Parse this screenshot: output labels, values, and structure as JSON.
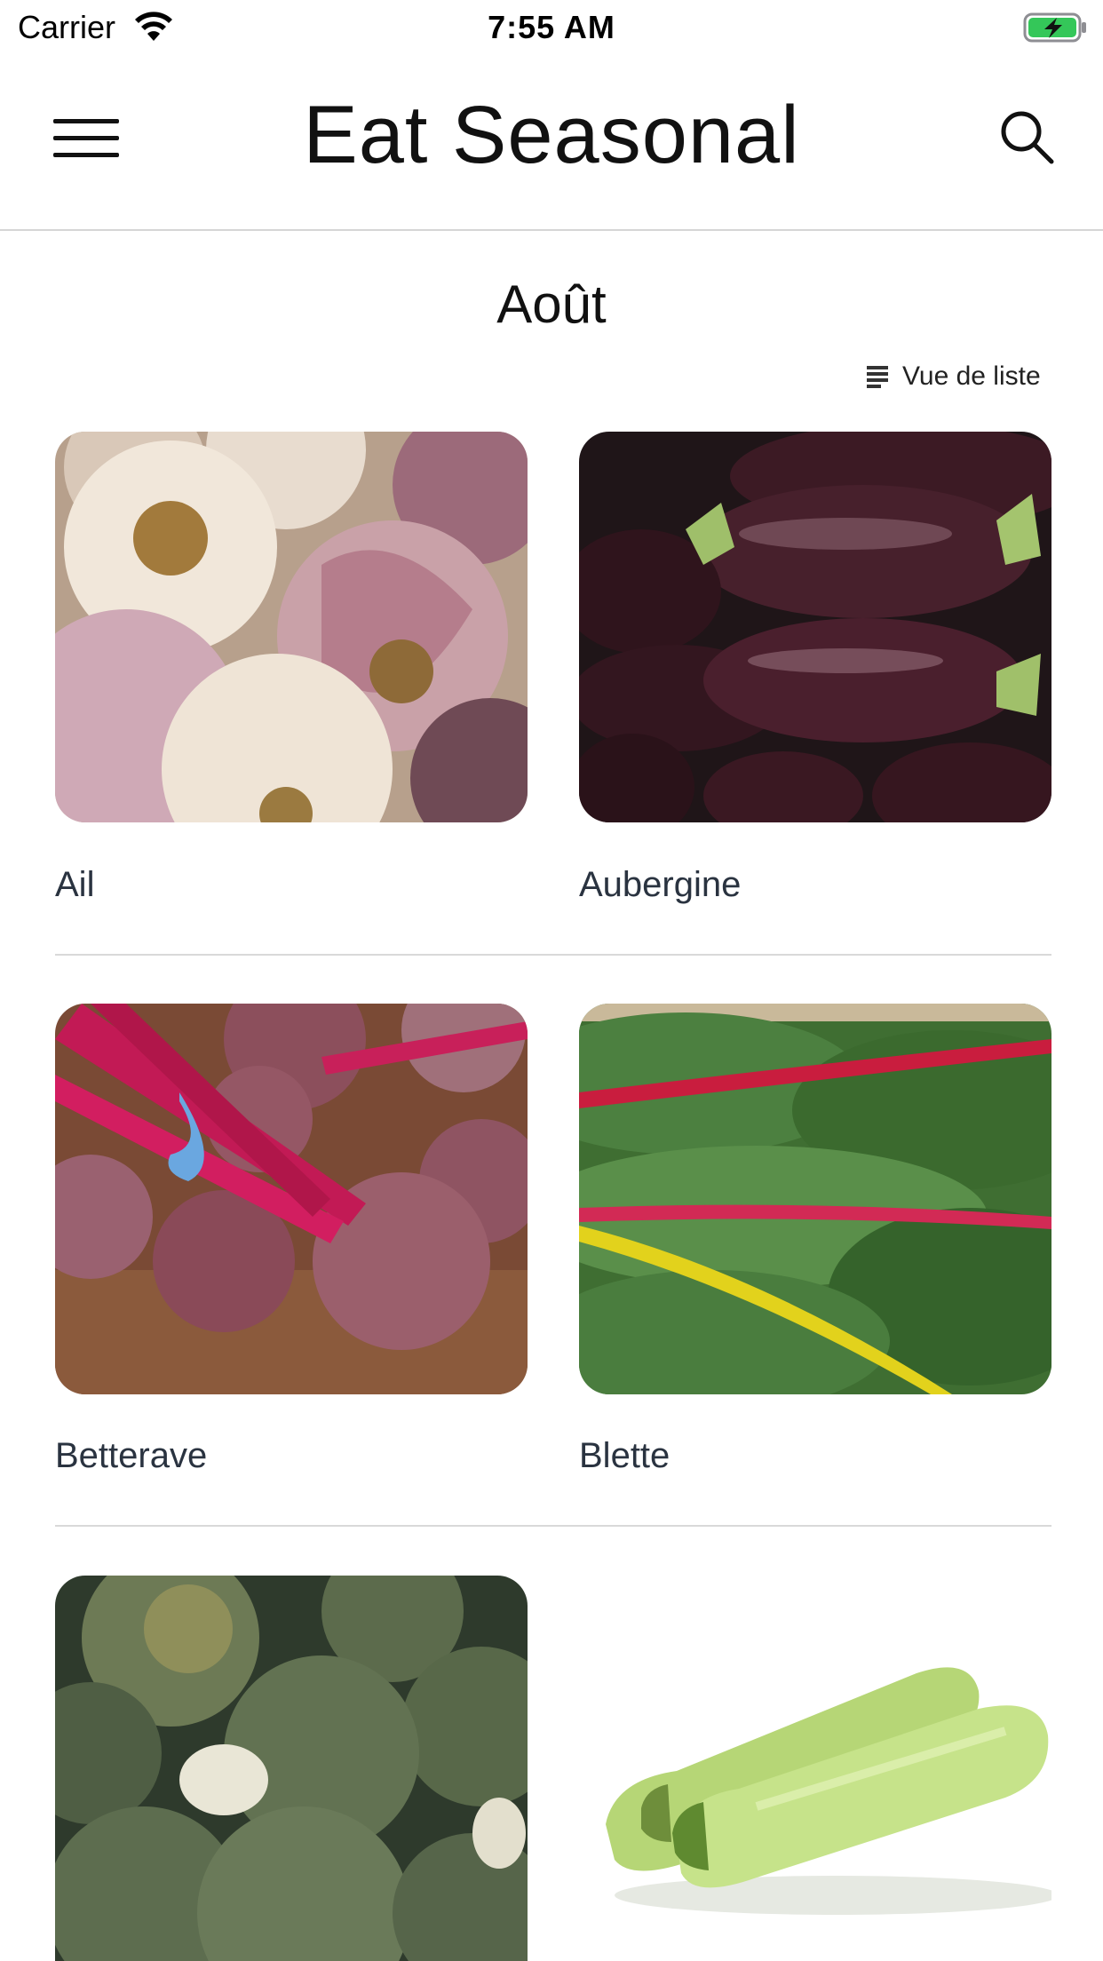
{
  "status_bar": {
    "carrier": "Carrier",
    "time": "7:55 AM",
    "wifi_icon": "wifi-icon",
    "battery_icon": "battery-charging-icon",
    "battery_color": "#34c759"
  },
  "header": {
    "title": "Eat Seasonal",
    "menu_icon": "hamburger-menu-icon",
    "search_icon": "search-icon"
  },
  "month": {
    "title": "Août"
  },
  "view_toggle": {
    "label": "Vue de liste",
    "icon": "list-icon"
  },
  "items": [
    {
      "name": "Ail",
      "image": "garlic-photo"
    },
    {
      "name": "Aubergine",
      "image": "eggplant-photo"
    },
    {
      "name": "Betterave",
      "image": "beetroot-photo"
    },
    {
      "name": "Blette",
      "image": "chard-photo"
    },
    {
      "name": "",
      "image": "broccoli-photo"
    },
    {
      "name": "",
      "image": "zucchini-photo"
    }
  ],
  "colors": {
    "title": "#111111",
    "item_label": "#2a3340",
    "divider": "#d9d9d9"
  }
}
